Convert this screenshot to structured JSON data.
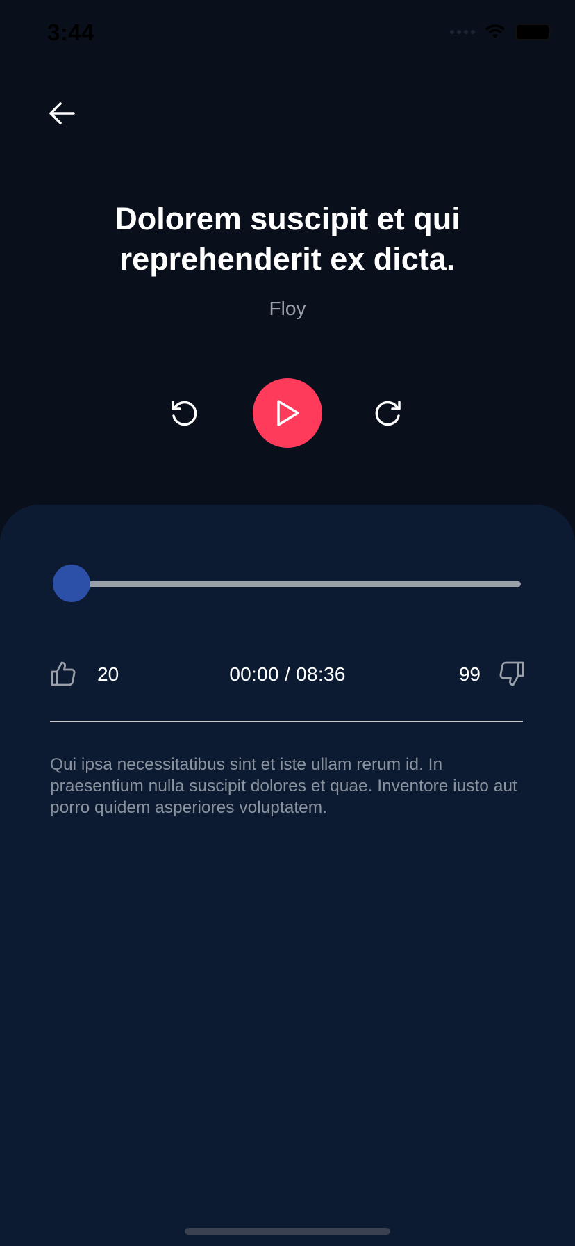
{
  "status_bar": {
    "time": "3:44"
  },
  "navigation": {
    "back_icon": "arrow-left-icon"
  },
  "episode": {
    "title": "Dolorem suscipit et qui reprehenderit ex dicta.",
    "author": "Floy",
    "description": "Qui ipsa necessitatibus sint et iste ullam rerum id. In praesentium nulla suscipit dolores et quae. Inventore iusto aut porro quidem asperiores voluptatem."
  },
  "player": {
    "rewind_icon": "rotate-ccw-icon",
    "play_icon": "play-icon",
    "forward_icon": "rotate-cw-icon",
    "progress_fraction": 0,
    "time_display": "00:00 / 08:36"
  },
  "reactions": {
    "likes": "20",
    "dislikes": "99",
    "like_icon": "thumbs-up-icon",
    "dislike_icon": "thumbs-down-icon"
  },
  "colors": {
    "background": "#0a0f1c",
    "panel": "#0c1b31",
    "accent_play": "#ff3b5c",
    "slider_thumb": "#2c4fa8",
    "slider_track": "#9aa0a8",
    "muted_text": "#9aa0aa"
  }
}
